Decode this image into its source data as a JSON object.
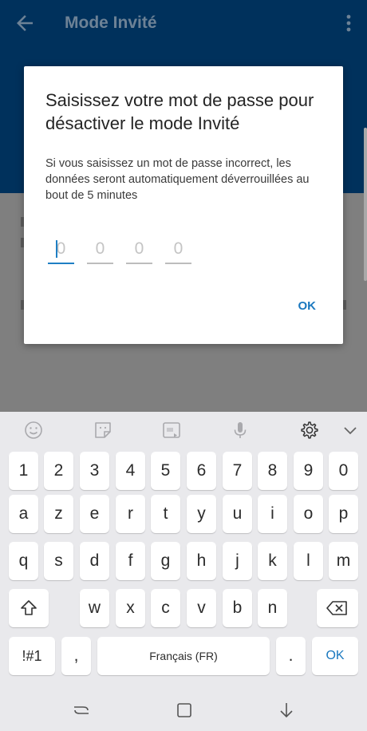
{
  "app_bar": {
    "title": "Mode Invité"
  },
  "dialog": {
    "heading": "Saisissez votre mot de passe pour désactiver le mode Invité",
    "message": "Si vous saisissez un mot de passe incorrect, les données seront automatiquement déverrouillées au bout de 5 minutes",
    "pin_placeholders": [
      "0",
      "0",
      "0",
      "0"
    ],
    "ok_label": "OK"
  },
  "keyboard": {
    "toolbar_icons": [
      "emoji-icon",
      "sticker-icon",
      "gif-icon",
      "microphone-icon",
      "settings-icon",
      "collapse-keyboard-icon"
    ],
    "row_numbers": [
      "1",
      "2",
      "3",
      "4",
      "5",
      "6",
      "7",
      "8",
      "9",
      "0"
    ],
    "row_1": [
      "a",
      "z",
      "e",
      "r",
      "t",
      "y",
      "u",
      "i",
      "o",
      "p"
    ],
    "row_2": [
      "q",
      "s",
      "d",
      "f",
      "g",
      "h",
      "j",
      "k",
      "l",
      "m"
    ],
    "row_3": [
      "w",
      "x",
      "c",
      "v",
      "b",
      "n"
    ],
    "symbols_label": "!#1",
    "comma_label": ",",
    "space_label": "Français (FR)",
    "period_label": ".",
    "ok_label": "OK"
  },
  "colors": {
    "app_bar": "#00315c",
    "accent": "#1a78bf"
  }
}
